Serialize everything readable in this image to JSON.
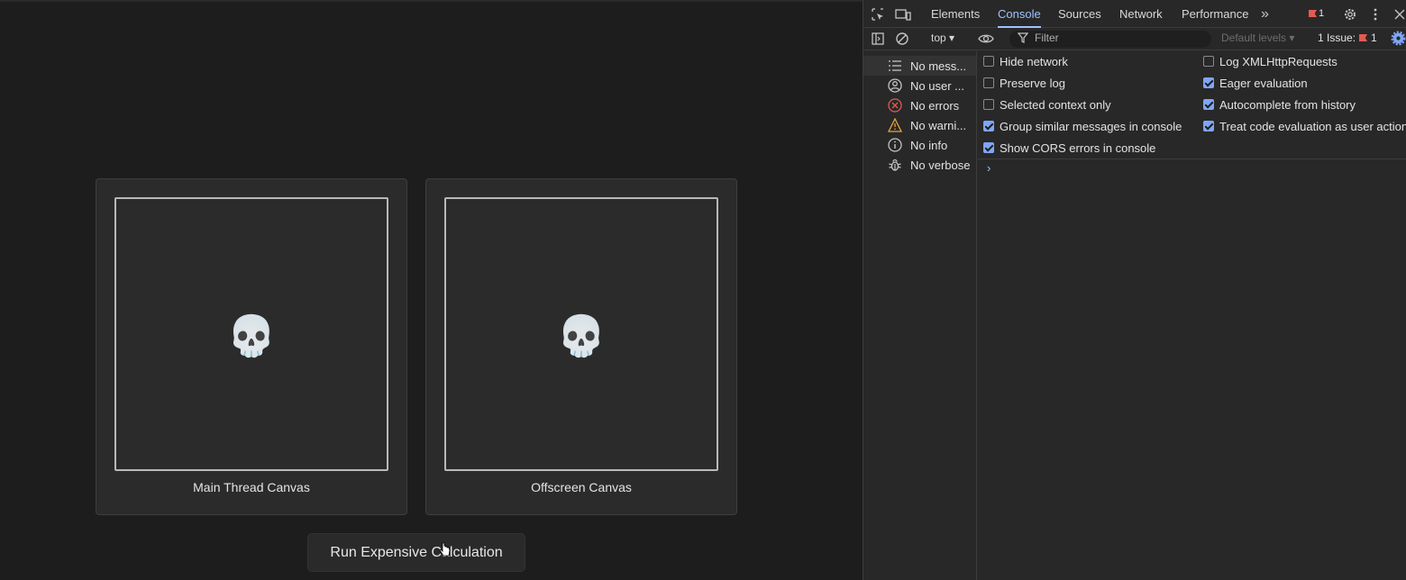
{
  "page": {
    "cards": [
      {
        "emoji": "💀",
        "label": "Main Thread Canvas"
      },
      {
        "emoji": "💀",
        "label": "Offscreen Canvas"
      }
    ],
    "run_button": "Run Expensive Calculation"
  },
  "devtools": {
    "tabs": [
      "Elements",
      "Console",
      "Sources",
      "Network",
      "Performance"
    ],
    "active_tab": "Console",
    "more_tabs": "»",
    "error_count": "1",
    "toolbar": {
      "context": "top ▾",
      "filter_placeholder": "Filter",
      "levels": "Default levels ▾",
      "issues_label": "1 Issue:",
      "issues_count": "1"
    },
    "sidebar": [
      {
        "label": "No mess...",
        "icon": "list-icon"
      },
      {
        "label": "No user ...",
        "icon": "user-icon"
      },
      {
        "label": "No errors",
        "icon": "error-icon"
      },
      {
        "label": "No warni...",
        "icon": "warning-icon"
      },
      {
        "label": "No info",
        "icon": "info-icon"
      },
      {
        "label": "No verbose",
        "icon": "bug-icon"
      }
    ],
    "settings_left": [
      {
        "label": "Hide network",
        "checked": false
      },
      {
        "label": "Preserve log",
        "checked": false
      },
      {
        "label": "Selected context only",
        "checked": false
      },
      {
        "label": "Group similar messages in console",
        "checked": true
      },
      {
        "label": "Show CORS errors in console",
        "checked": true
      }
    ],
    "settings_right": [
      {
        "label": "Log XMLHttpRequests",
        "checked": false
      },
      {
        "label": "Eager evaluation",
        "checked": true
      },
      {
        "label": "Autocomplete from history",
        "checked": true
      },
      {
        "label": "Treat code evaluation as user action",
        "checked": true
      }
    ],
    "prompt": "›"
  },
  "colors": {
    "accent": "#7fa6f5",
    "error": "#e35a52",
    "warning": "#e8a33a"
  }
}
